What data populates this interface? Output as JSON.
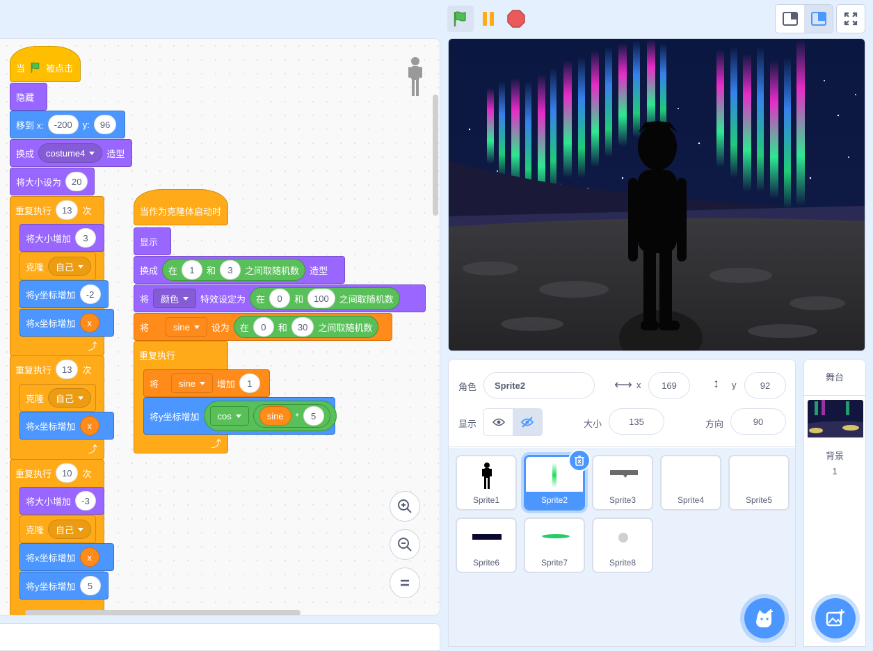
{
  "scripts": {
    "main": {
      "hat_when": "当",
      "hat_clicked": "被点击",
      "hide": "隐藏",
      "goto_label": "移到 x:",
      "goto_x": "-200",
      "goto_y_label": "y:",
      "goto_y": "96",
      "switch_label": "换成",
      "switch_costume": "costume4",
      "switch_suffix": "造型",
      "setsize_label": "将大小设为",
      "setsize_value": "20",
      "repeat1_label": "重复执行",
      "repeat1_count": "13",
      "repeat_times": "次",
      "change_size_label": "将大小增加",
      "change_size1": "3",
      "clone_label": "克隆",
      "clone_target": "自己",
      "change_y_label": "将y坐标增加",
      "change_y1": "-2",
      "change_x_label": "将x坐标增加",
      "var_x": "x",
      "repeat2_count": "13",
      "repeat3_count": "10",
      "change_size3": "-3",
      "change_y3": "5"
    },
    "clone": {
      "hat": "当作为克隆体启动时",
      "show": "显示",
      "switch_label": "换成",
      "in": "在",
      "and": "和",
      "random": "之间取随机数",
      "costume_suffix": "造型",
      "rand1_from": "1",
      "rand1_to": "3",
      "set_label": "将",
      "effect": "颜色",
      "effect_set": "特效设定为",
      "rand2_from": "0",
      "rand2_to": "100",
      "var_sine": "sine",
      "set_to": "设为",
      "rand3_from": "0",
      "rand3_to": "30",
      "forever": "重复执行",
      "change_label": "增加",
      "change_value": "1",
      "change_y_label": "将y坐标增加",
      "cos": "cos",
      "times": "*",
      "mult": "5"
    }
  },
  "sprite_info": {
    "sprite_label": "角色",
    "sprite_name": "Sprite2",
    "x_label": "x",
    "x_value": "169",
    "y_label": "y",
    "y_value": "92",
    "show_label": "显示",
    "size_label": "大小",
    "size_value": "135",
    "direction_label": "方向",
    "direction_value": "90"
  },
  "sprites": [
    {
      "name": "Sprite1"
    },
    {
      "name": "Sprite2",
      "selected": true
    },
    {
      "name": "Sprite3"
    },
    {
      "name": "Sprite4"
    },
    {
      "name": "Sprite5"
    },
    {
      "name": "Sprite6"
    },
    {
      "name": "Sprite7"
    },
    {
      "name": "Sprite8"
    }
  ],
  "stage_panel": {
    "title": "舞台",
    "backdrop_label": "背景",
    "backdrop_count": "1"
  },
  "colors": {
    "events": "#ffbf00",
    "looks": "#9966ff",
    "motion": "#4c97ff",
    "control": "#ffab19",
    "variables": "#ff8c1a",
    "operators": "#59c059"
  }
}
